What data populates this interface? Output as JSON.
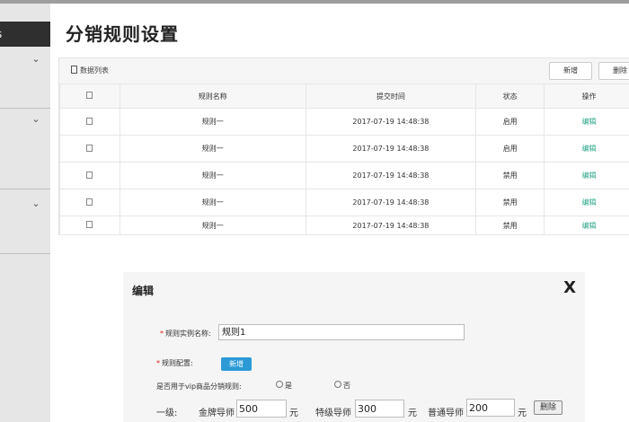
{
  "page_title": "分销规则设置",
  "sidebar": {
    "header": "s",
    "groups": [
      {},
      {},
      {}
    ]
  },
  "toolbar": {
    "list_label": "数据列表",
    "add_label": "新增",
    "delete_label": "删除"
  },
  "table": {
    "headers": [
      "",
      "规则名称",
      "提交时间",
      "状态",
      "操作"
    ],
    "rows": [
      {
        "name": "规则一",
        "time": "2017-07-19 14:48:38",
        "status": "启用",
        "action": "编辑"
      },
      {
        "name": "规则一",
        "time": "2017-07-19 14:48:38",
        "status": "启用",
        "action": "编辑"
      },
      {
        "name": "规则一",
        "time": "2017-07-19 14:48:38",
        "status": "禁用",
        "action": "编辑"
      },
      {
        "name": "规则一",
        "time": "2017-07-19 14:48:38",
        "status": "禁用",
        "action": "编辑"
      },
      {
        "name": "规则一",
        "time": "2017-07-19 14:48:38",
        "status": "禁用",
        "action": "编辑"
      }
    ]
  },
  "modal": {
    "title": "编辑",
    "close": "X",
    "rule_name_label": "规则实例名称:",
    "rule_name_value": "规则1",
    "rule_config_label": "规则配置:",
    "add_btn": "新增",
    "vip_question": "是否用于vip商品分销规则:",
    "opt_yes": "是",
    "opt_no": "否",
    "level_label": "一级:",
    "gold_label": "金牌导师",
    "gold_value": "500",
    "special_label": "特级导师",
    "special_value": "300",
    "normal_label": "普通导师",
    "normal_value": "200",
    "unit": "元",
    "delete_btn": "删除"
  }
}
